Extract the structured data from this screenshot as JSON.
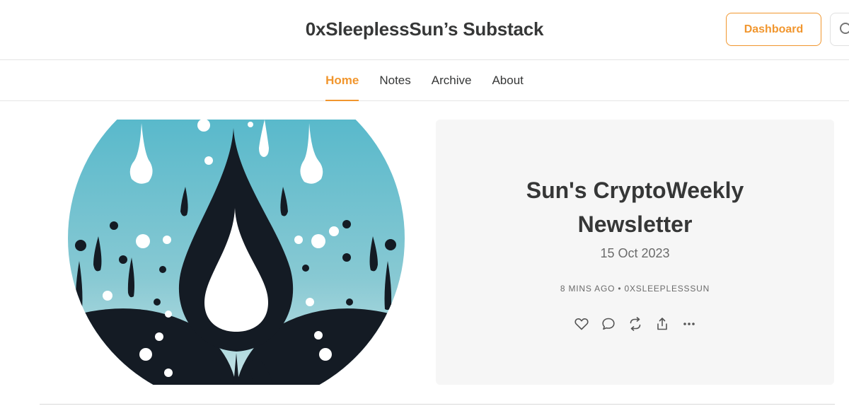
{
  "header": {
    "site_title": "0xSleeplessSun’s Substack",
    "dashboard_label": "Dashboard"
  },
  "nav": {
    "tabs": [
      {
        "label": "Home",
        "active": true
      },
      {
        "label": "Notes",
        "active": false
      },
      {
        "label": "Archive",
        "active": false
      },
      {
        "label": "About",
        "active": false
      }
    ]
  },
  "post": {
    "title": "Sun's CryptoWeekly Newsletter",
    "date": "15 Oct 2023",
    "meta": "8 MINS AGO • 0XSLEEPLESSSUN",
    "actions": [
      "like-icon",
      "comment-icon",
      "restack-icon",
      "share-icon",
      "more-icon"
    ]
  },
  "colors": {
    "accent": "#f1962e",
    "text": "#363737",
    "card_bg": "#f6f6f6",
    "art_teal": "#5bb8c9",
    "art_dark": "#141b24"
  }
}
